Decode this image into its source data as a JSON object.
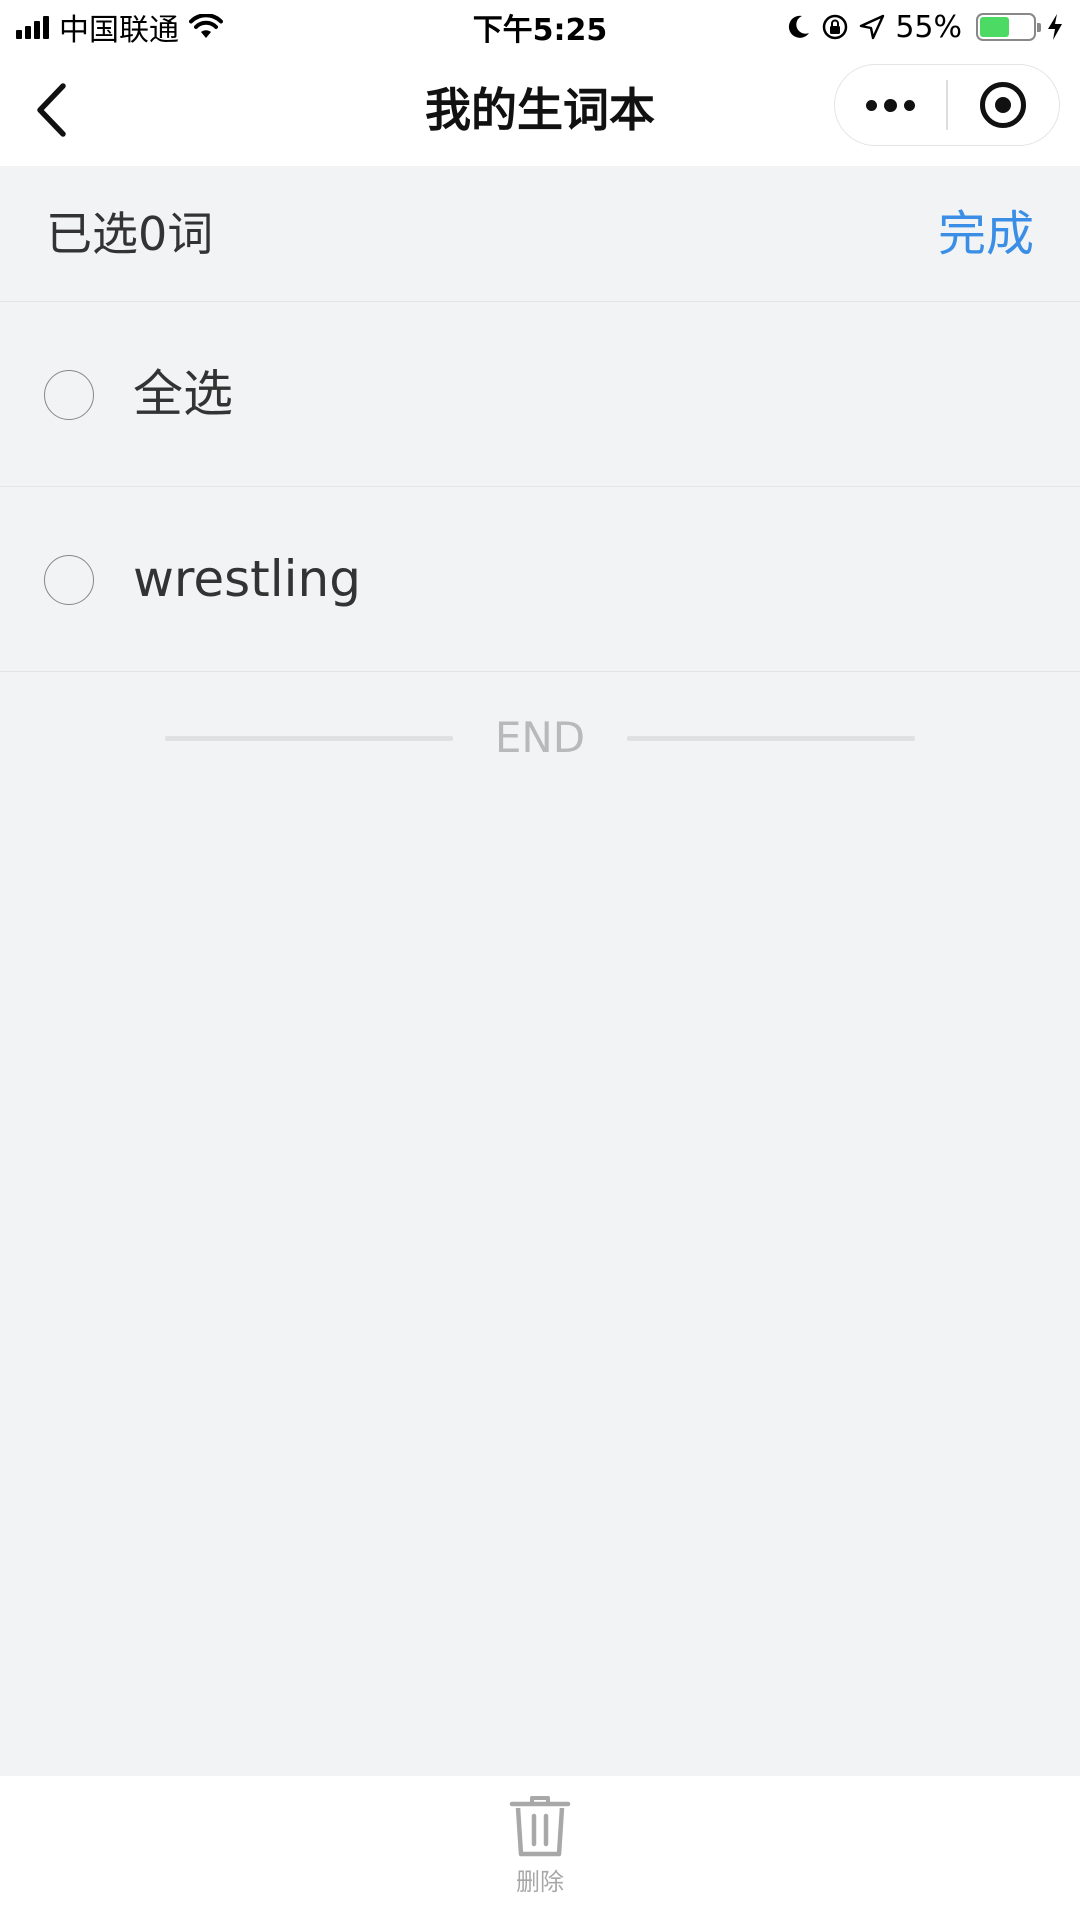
{
  "status_bar": {
    "carrier": "中国联通",
    "time": "下午5:25",
    "battery": "55%",
    "battery_level": 0.55,
    "icons": [
      "signal-icon",
      "wifi-icon",
      "moon-icon",
      "rotation-lock-icon",
      "location-icon",
      "battery-icon",
      "charging-icon"
    ]
  },
  "nav": {
    "title": "我的生词本",
    "icons": [
      "back-icon",
      "more-icon",
      "target-icon"
    ]
  },
  "selection": {
    "count_text": "已选0词",
    "done_label": "完成"
  },
  "list": {
    "select_all": {
      "label": "全选",
      "checked": false
    },
    "items": [
      {
        "word": "wrestling",
        "checked": false
      }
    ]
  },
  "end_text": "END",
  "toolbar": {
    "delete_label": "删除",
    "delete_icon": "trash-icon"
  },
  "colors": {
    "accent": "#3a8ee6",
    "background": "#f2f3f5",
    "battery": "#4cd964"
  }
}
